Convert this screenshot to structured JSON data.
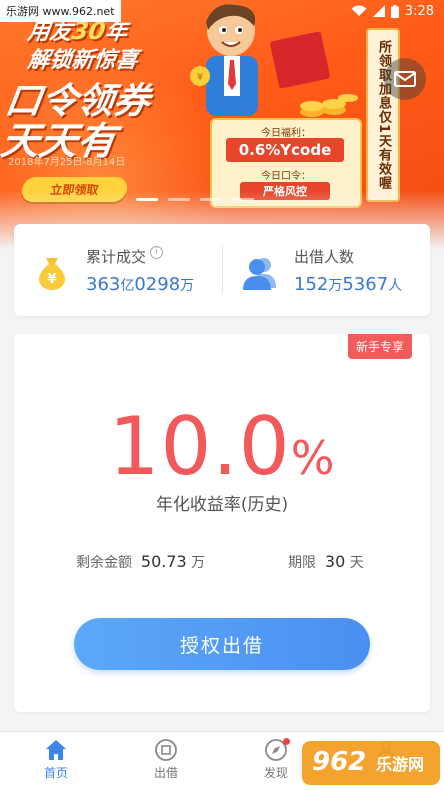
{
  "status_bar": {
    "time": "3:28"
  },
  "watermark": {
    "top_text": "乐游网 www.962.net",
    "logo_text": "962",
    "logo_sub": "乐游网"
  },
  "banner": {
    "line1_prefix": "用友",
    "line1_num": "30",
    "line1_suffix": "年",
    "line2": "解锁新惊喜",
    "line3": "口令领券",
    "line4": "天天有",
    "date_range": "2018年7月25日-8月14日",
    "cta_label": "立即领取",
    "today_welfare_label": "今日福利：",
    "today_welfare_value": "0.6%Ycode",
    "today_code_label": "今日口令：",
    "today_code_value": "严格风控",
    "scroll_text": "所领取加息仅1天有效喔",
    "carousel_count": 4,
    "carousel_active": 0,
    "colors": {
      "orange": "#ff5b18",
      "yellow": "#ffd23c",
      "red": "#e8452a"
    }
  },
  "stats": {
    "cumulative": {
      "label": "累计成交",
      "value_num1": "363",
      "value_unit1": "亿",
      "value_num2": "0298",
      "value_unit2": "万",
      "icon": "money-bag-icon"
    },
    "borrowers": {
      "label": "出借人数",
      "value_num1": "152",
      "value_unit1": "万",
      "value_num2": "5367",
      "value_unit2": "人",
      "icon": "people-icon"
    }
  },
  "product": {
    "tag": "新手专享",
    "rate_int": "10.",
    "rate_dec": "0",
    "rate_pct": "%",
    "rate_label": "年化收益率(历史)",
    "remaining_label": "剩余金额",
    "remaining_value": "50.73",
    "remaining_unit": "万",
    "term_label": "期限",
    "term_value": "30",
    "term_unit": "天",
    "button_label": "授权出借",
    "colors": {
      "rate": "#f2595b",
      "button": "#4a8ff0"
    }
  },
  "tabbar": {
    "items": [
      {
        "label": "首页",
        "icon": "home-icon",
        "active": true
      },
      {
        "label": "出借",
        "icon": "lend-icon",
        "active": false
      },
      {
        "label": "发现",
        "icon": "compass-icon",
        "active": false
      },
      {
        "label": "",
        "icon": "account-icon",
        "active": false
      }
    ]
  }
}
